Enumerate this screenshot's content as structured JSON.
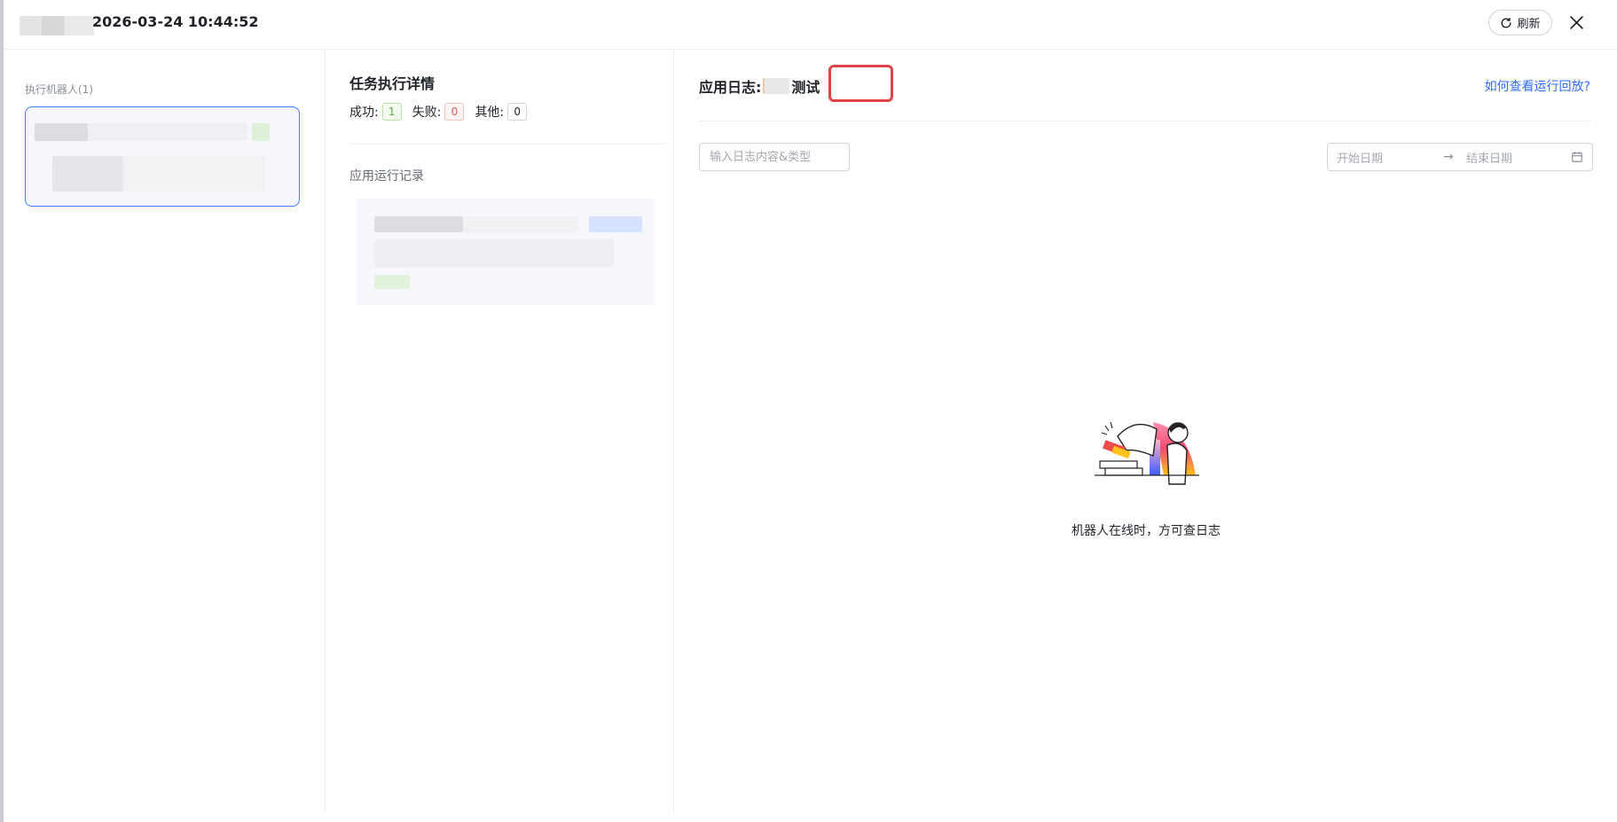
{
  "header": {
    "datetime": "2026-03-24 10:44:52",
    "refresh_label": "刷新"
  },
  "left_panel": {
    "label": "执行机器人(1)"
  },
  "middle_panel": {
    "title": "任务执行详情",
    "stats": {
      "success_label": "成功:",
      "success_count": "1",
      "fail_label": "失败:",
      "fail_count": "0",
      "other_label": "其他:",
      "other_count": "0"
    },
    "run_records_label": "应用运行记录"
  },
  "right_panel": {
    "title_prefix": "应用日志:",
    "title_suffix": "测试",
    "help_link": "如何查看运行回放?",
    "search_placeholder": "输入日志内容&类型",
    "date_start_placeholder": "开始日期",
    "date_end_placeholder": "结束日期",
    "date_separator": "→",
    "empty_message": "机器人在线时，方可查日志"
  },
  "colors": {
    "accent": "#2f6bff",
    "success": "#52b03a",
    "fail": "#e35656",
    "highlight": "#e04545"
  }
}
